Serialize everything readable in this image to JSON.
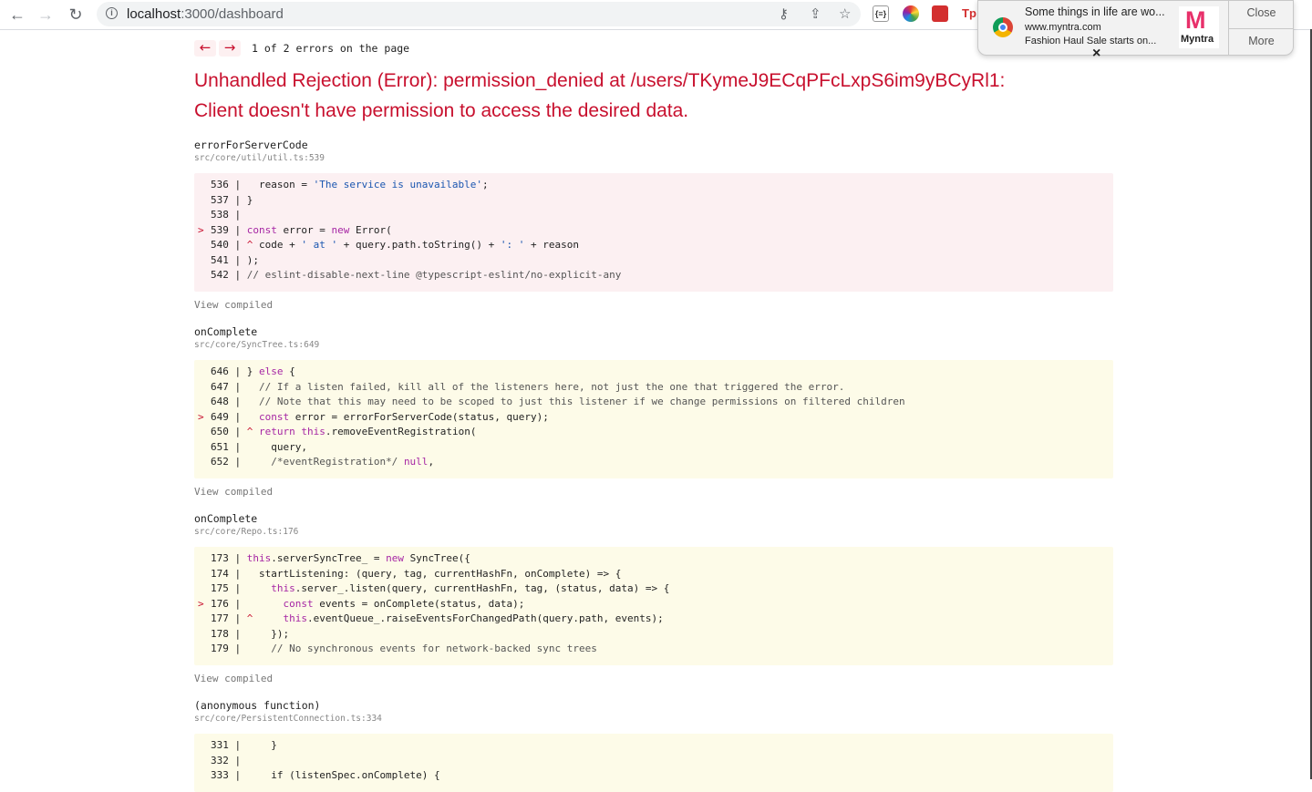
{
  "browser": {
    "url_host": "localhost",
    "url_path": ":3000/dashboard",
    "ext_label_1": "{≡}",
    "ext_label_4": "Tp"
  },
  "notification": {
    "title": "Some things in life are wo...",
    "site": "www.myntra.com",
    "body": "Fashion Haul Sale starts on...",
    "logo_mark": "M",
    "logo_label": "Myntra",
    "close_label": "Close",
    "more_label": "More"
  },
  "overlay": {
    "prev": "←",
    "next": "→",
    "count": "1 of 2 errors on the page",
    "title_line1": "Unhandled Rejection (Error): permission_denied at /users/TKymeJ9ECqPFcLxpS6im9yBCyRl1:",
    "title_line2": "Client doesn't have permission to access the desired data.",
    "view_compiled": "View compiled",
    "frames": [
      {
        "fn": "errorForServerCode",
        "file": "src/core/util/util.ts:539",
        "lines": [
          {
            "gutter": "",
            "num": "536",
            "sep": " |   ",
            "code": "reason = 'The service is unavailable';"
          },
          {
            "gutter": "",
            "num": "537",
            "sep": " | ",
            "code": "}"
          },
          {
            "gutter": "",
            "num": "538",
            "sep": " | ",
            "code": ""
          },
          {
            "gutter": ">",
            "num": "539",
            "sep": " | ",
            "code": "const error = new Error("
          },
          {
            "gutter": "",
            "num": "540",
            "sep": " | ^ ",
            "code": "code + ' at ' + query.path.toString() + ': ' + reason"
          },
          {
            "gutter": "",
            "num": "541",
            "sep": " | ",
            "code": ");"
          },
          {
            "gutter": "",
            "num": "542",
            "sep": " | ",
            "code": "// eslint-disable-next-line @typescript-eslint/no-explicit-any"
          }
        ]
      },
      {
        "fn": "onComplete",
        "file": "src/core/SyncTree.ts:649",
        "lines": [
          {
            "gutter": "",
            "num": "646",
            "sep": " | ",
            "code": "} else {"
          },
          {
            "gutter": "",
            "num": "647",
            "sep": " |   ",
            "code": "// If a listen failed, kill all of the listeners here, not just the one that triggered the error."
          },
          {
            "gutter": "",
            "num": "648",
            "sep": " |   ",
            "code": "// Note that this may need to be scoped to just this listener if we change permissions on filtered children"
          },
          {
            "gutter": ">",
            "num": "649",
            "sep": " |   ",
            "code": "const error = errorForServerCode(status, query);"
          },
          {
            "gutter": "",
            "num": "650",
            "sep": " | ^ ",
            "code": "return this.removeEventRegistration("
          },
          {
            "gutter": "",
            "num": "651",
            "sep": " |     ",
            "code": "query,"
          },
          {
            "gutter": "",
            "num": "652",
            "sep": " |     ",
            "code": "/*eventRegistration*/ null,"
          }
        ]
      },
      {
        "fn": "onComplete",
        "file": "src/core/Repo.ts:176",
        "lines": [
          {
            "gutter": "",
            "num": "173",
            "sep": " | ",
            "code": "this.serverSyncTree_ = new SyncTree({"
          },
          {
            "gutter": "",
            "num": "174",
            "sep": " |   ",
            "code": "startListening: (query, tag, currentHashFn, onComplete) => {"
          },
          {
            "gutter": "",
            "num": "175",
            "sep": " |     ",
            "code": "this.server_.listen(query, currentHashFn, tag, (status, data) => {"
          },
          {
            "gutter": ">",
            "num": "176",
            "sep": " |       ",
            "code": "const events = onComplete(status, data);"
          },
          {
            "gutter": "",
            "num": "177",
            "sep": " | ^     ",
            "code": "this.eventQueue_.raiseEventsForChangedPath(query.path, events);"
          },
          {
            "gutter": "",
            "num": "178",
            "sep": " |     ",
            "code": "});"
          },
          {
            "gutter": "",
            "num": "179",
            "sep": " |     ",
            "code": "// No synchronous events for network-backed sync trees"
          }
        ]
      },
      {
        "fn": "(anonymous function)",
        "file": "src/core/PersistentConnection.ts:334",
        "lines": [
          {
            "gutter": "",
            "num": "331",
            "sep": " |     ",
            "code": "}"
          },
          {
            "gutter": "",
            "num": "332",
            "sep": " | ",
            "code": ""
          },
          {
            "gutter": "",
            "num": "333",
            "sep": " |     ",
            "code": "if (listenSpec.onComplete) {"
          }
        ]
      }
    ]
  }
}
